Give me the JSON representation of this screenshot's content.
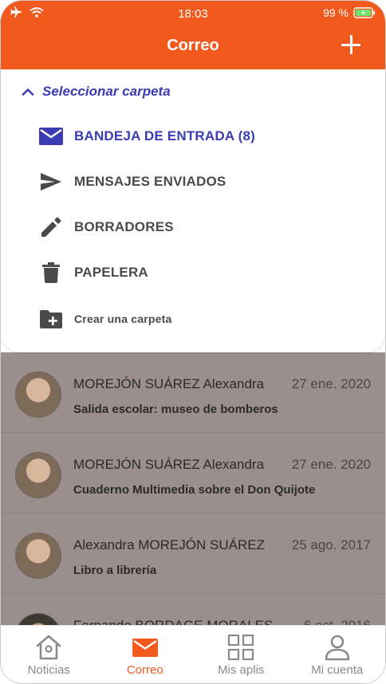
{
  "status_bar": {
    "time": "18:03",
    "battery_percent": "99 %"
  },
  "header": {
    "title": "Correo",
    "add_icon": "plus-icon"
  },
  "folder_picker": {
    "title": "Seleccionar carpeta",
    "folders": [
      {
        "label": "BANDEJA DE ENTRADA (8)",
        "icon": "envelope-icon",
        "active": true
      },
      {
        "label": "MENSAJES ENVIADOS",
        "icon": "send-icon",
        "active": false
      },
      {
        "label": "BORRADORES",
        "icon": "pencil-icon",
        "active": false
      },
      {
        "label": "PAPELERA",
        "icon": "trash-icon",
        "active": false
      }
    ],
    "create_label": "Crear una carpeta"
  },
  "messages": [
    {
      "sender": "MOREJÓN SUÁREZ Alexandra",
      "date": "27 ene. 2020",
      "subject": "Salida escolar: museo de bomberos"
    },
    {
      "sender": "MOREJÓN SUÁREZ Alexandra",
      "date": "27 ene. 2020",
      "subject": "Cuaderno Multimedia sobre el Don Quijote"
    },
    {
      "sender": "Alexandra MOREJÓN SUÁREZ",
      "date": "25 ago. 2017",
      "subject": "Libro a librería"
    },
    {
      "sender": "Fernando BORDAGE MORALES",
      "date": "6 oct. 2016",
      "subject": ""
    }
  ],
  "tabs": [
    {
      "label": "Noticias",
      "icon": "home-icon",
      "active": false
    },
    {
      "label": "Correo",
      "icon": "mail-icon",
      "active": true
    },
    {
      "label": "Mis aplis",
      "icon": "grid-icon",
      "active": false
    },
    {
      "label": "Mi cuenta",
      "icon": "user-icon",
      "active": false
    }
  ],
  "colors": {
    "accent": "#f25a1d",
    "folder_active": "#3b3bb3",
    "overlay": "#9b8f8d"
  }
}
